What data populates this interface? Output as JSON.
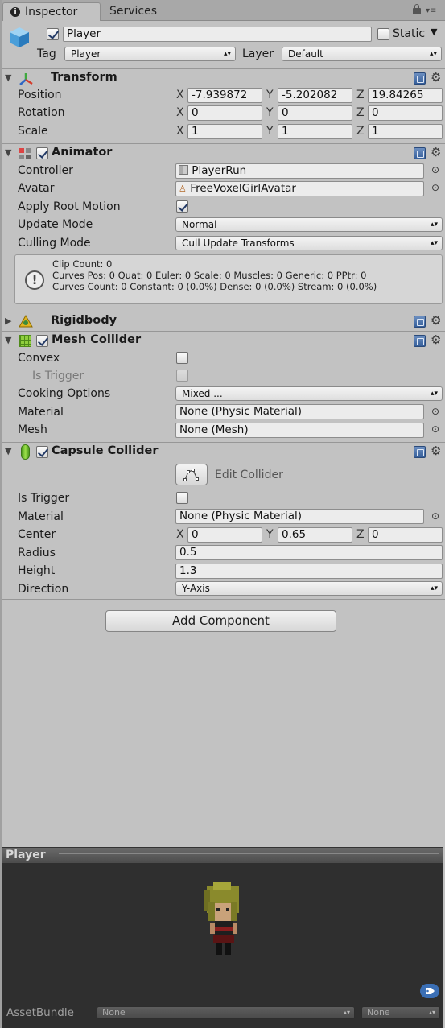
{
  "tabs": {
    "inspector": "Inspector",
    "services": "Services"
  },
  "header": {
    "name": "Player",
    "active": true,
    "static_label": "Static",
    "tag_label": "Tag",
    "tag_value": "Player",
    "layer_label": "Layer",
    "layer_value": "Default"
  },
  "transform": {
    "title": "Transform",
    "position": {
      "label": "Position",
      "x": "-7.939872",
      "y": "-5.202082",
      "z": "19.84265"
    },
    "rotation": {
      "label": "Rotation",
      "x": "0",
      "y": "0",
      "z": "0"
    },
    "scale": {
      "label": "Scale",
      "x": "1",
      "y": "1",
      "z": "1"
    },
    "axis_x": "X",
    "axis_y": "Y",
    "axis_z": "Z"
  },
  "animator": {
    "title": "Animator",
    "controller_label": "Controller",
    "controller_value": "PlayerRun",
    "avatar_label": "Avatar",
    "avatar_value": "FreeVoxelGirlAvatar",
    "apply_root_label": "Apply Root Motion",
    "apply_root_checked": true,
    "update_mode_label": "Update Mode",
    "update_mode_value": "Normal",
    "culling_mode_label": "Culling Mode",
    "culling_mode_value": "Cull Update Transforms",
    "info_lines": [
      "Clip Count: 0",
      "Curves Pos: 0 Quat: 0 Euler: 0 Scale: 0 Muscles: 0 Generic: 0 PPtr: 0",
      "Curves Count: 0 Constant: 0 (0.0%) Dense: 0 (0.0%) Stream: 0 (0.0%)"
    ]
  },
  "rigidbody": {
    "title": "Rigidbody"
  },
  "mesh_collider": {
    "title": "Mesh Collider",
    "convex_label": "Convex",
    "is_trigger_label": "Is Trigger",
    "cooking_label": "Cooking Options",
    "cooking_value": "Mixed ...",
    "material_label": "Material",
    "material_value": "None (Physic Material)",
    "mesh_label": "Mesh",
    "mesh_value": "None (Mesh)"
  },
  "capsule_collider": {
    "title": "Capsule Collider",
    "edit_collider_label": "Edit Collider",
    "is_trigger_label": "Is Trigger",
    "material_label": "Material",
    "material_value": "None (Physic Material)",
    "center_label": "Center",
    "center": {
      "x": "0",
      "y": "0.65",
      "z": "0"
    },
    "radius_label": "Radius",
    "radius_value": "0.5",
    "height_label": "Height",
    "height_value": "1.3",
    "direction_label": "Direction",
    "direction_value": "Y-Axis"
  },
  "add_component_label": "Add Component",
  "preview": {
    "title": "Player",
    "assetbundle_label": "AssetBundle",
    "assetbundle_value": "None",
    "variant_value": "None"
  },
  "icons": {
    "info": "info-icon",
    "lock": "lock-icon",
    "menu": "menu-icon",
    "cube": "cube-icon",
    "transform": "transform-icon",
    "animator": "animator-icon",
    "rigidbody": "rigidbody-icon",
    "mesh": "mesh-collider-icon",
    "capsule": "capsule-collider-icon",
    "help": "help-book-icon",
    "gear": "gear-icon",
    "object_picker": "object-picker-icon",
    "edit_collider": "edit-collider-icon",
    "tag": "asset-label-icon"
  },
  "colors": {
    "panel": "#c2c2c2",
    "field": "#ececec",
    "preview_bg": "#2f2f2f",
    "help_blue": "#355e9a"
  }
}
